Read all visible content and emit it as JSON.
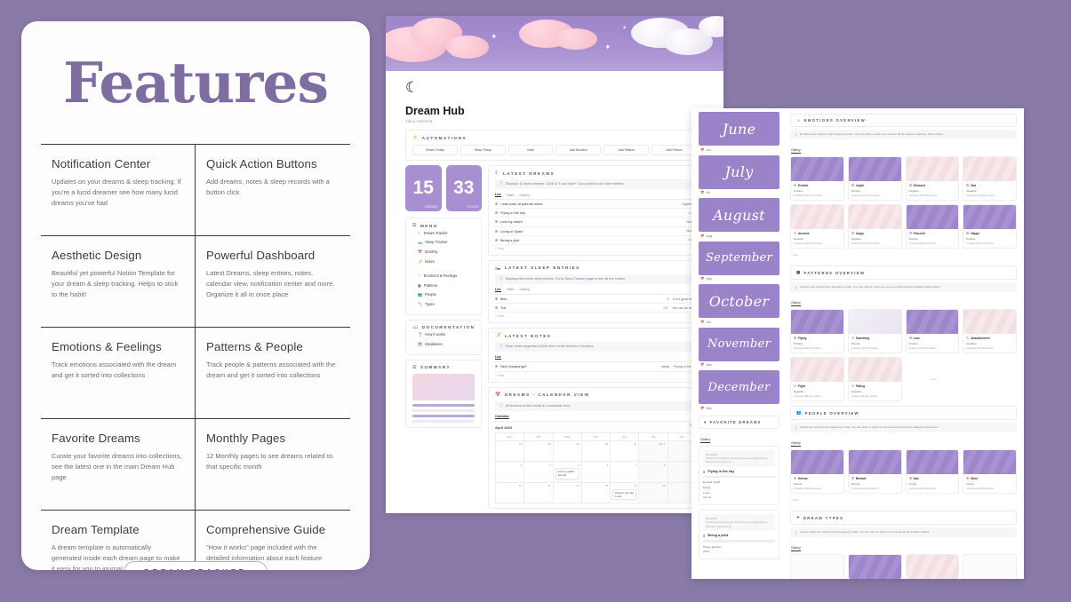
{
  "theme": {
    "background": "#8a7aa8",
    "accent": "#7e6da0",
    "card": "#ffffff",
    "notion_purple": "#a78fd0"
  },
  "features_card": {
    "title": "Features",
    "badge": "DREAM TRACKER",
    "items": [
      {
        "title": "Notification Center",
        "desc": "Updates on your dreams & sleep tracking, if you're a lucid dreamer see how many lucid dreams you've had"
      },
      {
        "title": "Quick Action Buttons",
        "desc": "Add dreams, notes & sleep records with a button click"
      },
      {
        "title": "Aesthetic Design",
        "desc": "Beautiful yet powerful Notion Template for your dream & sleep tracking. Helps to stick to the habit!"
      },
      {
        "title": "Powerful Dashboard",
        "desc": "Latest Dreams, sleep entries, notes, calendar view, notification center and more. Organize it all in once place"
      },
      {
        "title": "Emotions & Feelings",
        "desc": "Track emotions associated with the dream and get it sorted into collections"
      },
      {
        "title": "Patterns & People",
        "desc": "Track people & patterns associated with the dream and get it sorted into collections"
      },
      {
        "title": "Favorite Dreams",
        "desc": "Curate your favorite dreams into collections, see the latest one in the main Dream Hub page"
      },
      {
        "title": "Monthly Pages",
        "desc": "12 Monthly pages to see dreams related to that specific month"
      },
      {
        "title": "Dream Template",
        "desc": "A dream template is automatically generated inside each dream page to make it easy for you to journal"
      },
      {
        "title": "Comprehensive Guide",
        "desc": "\"How it works\" page included with the detailed information about each feature"
      }
    ]
  },
  "notion": {
    "icon": "☾",
    "title": "Dream Hub",
    "subtitle": "Add a comment",
    "automations": {
      "heading": "AUTOMATIONS",
      "buttons": [
        "Dream Today",
        "Sleep Today",
        "Note",
        "Add Emotion",
        "Add Pattern",
        "Add Person"
      ]
    },
    "stats": [
      {
        "value": "15",
        "caption": "DREAMS"
      },
      {
        "value": "33",
        "caption": "HOURS"
      }
    ],
    "menu": {
      "heading": "MENU",
      "items": [
        "Dream Tracker",
        "Sleep Tracker",
        "Monthly",
        "Notes"
      ],
      "items2": [
        "Emotions & Feelings",
        "Patterns",
        "People",
        "Types"
      ]
    },
    "documentation": {
      "heading": "DOCUMENTATION",
      "items": [
        "How it works",
        "Databases"
      ]
    },
    "summary": {
      "heading": "SUMMARY"
    },
    "latest_dreams": {
      "heading": "LATEST DREAMS",
      "callout": "Displays 10 latest dreams. Click to \"Load more\" if you want to see older entries.",
      "tabs": [
        "List",
        "Table",
        "Gallery"
      ],
      "rows": [
        {
          "name": "I was back at parents home",
          "tag": "Nightmare"
        },
        {
          "name": "Flying in the sky",
          "tag": "Lucid"
        },
        {
          "name": "Lost my watch",
          "tag": "Normal"
        },
        {
          "name": "Living in Spain",
          "tag": "Normal"
        },
        {
          "name": "Being a pilot",
          "tag": "Lucid"
        }
      ],
      "new_label": "+ New"
    },
    "latest_sleep": {
      "heading": "LATEST SLEEP ENTRIES",
      "callout": "Displays this week sleep entries. Go to Sleep Tracker page to see all the entries.",
      "tabs": [
        "List",
        "Table",
        "Gallery"
      ],
      "rows": [
        {
          "name": "Mon",
          "value": "8",
          "tag": "8 hrs good sleep"
        },
        {
          "name": "Tue",
          "value": "7.5",
          "tag": "You can do better"
        }
      ],
      "new_label": "+ New"
    },
    "latest_notes": {
      "heading": "LATEST NOTES",
      "callout": "Keep notes organized & link them to the dreams it involves.",
      "tabs": [
        "List"
      ],
      "rows": [
        {
          "name": "New Dreamings?",
          "tag": "Ideas",
          "link": "Flying in the sky"
        }
      ],
      "new_label": "+ New"
    },
    "calendar": {
      "heading": "DREAMS - CALENDAR VIEW",
      "callout": "All dreams of this month in a calendar view.",
      "tab": "Calendar",
      "month": "April 2023",
      "today": "Today",
      "weekdays": [
        "Mon",
        "Tue",
        "Wed",
        "Thu",
        "Fri",
        "Sat",
        "Sun"
      ],
      "cells": [
        {
          "day": "27"
        },
        {
          "day": "28"
        },
        {
          "day": "29"
        },
        {
          "day": "30"
        },
        {
          "day": "31"
        },
        {
          "day": "Apr 1"
        },
        {
          "day": "2"
        },
        {
          "day": "3"
        },
        {
          "day": "4"
        },
        {
          "day": "5"
        },
        {
          "day": "6"
        },
        {
          "day": "7"
        },
        {
          "day": "8"
        },
        {
          "day": "9"
        },
        {
          "day": "10"
        },
        {
          "day": "11"
        },
        {
          "day": "12"
        },
        {
          "day": "13"
        },
        {
          "day": "14"
        },
        {
          "day": "15"
        },
        {
          "day": "16"
        }
      ],
      "events": [
        {
          "cell": 9,
          "name": "Lost my watch",
          "tag": "Normal"
        },
        {
          "cell": 18,
          "name": "Flying in the sky",
          "tag": "Lucid"
        }
      ]
    }
  },
  "right_panel": {
    "months": [
      {
        "name": "June",
        "label": "Jun"
      },
      {
        "name": "July",
        "label": "Jul"
      },
      {
        "name": "August",
        "label": "Aug"
      },
      {
        "name": "September",
        "label": "Sep"
      },
      {
        "name": "October",
        "label": "Oct"
      },
      {
        "name": "November",
        "label": "Nov"
      },
      {
        "name": "December",
        "label": "Dec"
      }
    ],
    "favorites": {
      "heading": "FAVORITE DREAMS",
      "tab": "Gallery",
      "cards": [
        {
          "journal_label": "JOURNAL",
          "journal_text": "I dreamt you're flying over the school, everything was so light and I wanted to fly",
          "title": "Flying in the sky",
          "meta": [
            "Excited  Joyful",
            "Flying",
            "Lucid",
            "Apr 14"
          ]
        },
        {
          "journal_label": "JOURNAL",
          "journal_text": "I dreamt you're flying over the school, everything was so light and I wanted to fly",
          "title": "Being a pilot",
          "meta": [
            "Happy  Excited",
            "Work"
          ]
        }
      ]
    },
    "emotions": {
      "heading": "EMOTIONS OVERVIEW",
      "callout": "Emotions are sorted in the Frequency order. You can click on each one and see all the dreams related to that emotion.",
      "tab": "Gallery",
      "cards": [
        {
          "name": "Excited",
          "type": "Positive",
          "count": "5 dreams with this emotion",
          "img": "purple"
        },
        {
          "name": "Joyful",
          "type": "Positive",
          "count": "4 dreams with this emotion",
          "img": "purple"
        },
        {
          "name": "Stressed",
          "type": "Negative",
          "count": "3 dreams with this emotion",
          "img": "pink"
        },
        {
          "name": "Sad",
          "type": "Negative",
          "count": "3 dreams with this emotion",
          "img": "pink"
        },
        {
          "name": "Anxious",
          "type": "Negative",
          "count": "2 dreams with this emotion",
          "img": "pink"
        },
        {
          "name": "Angry",
          "type": "Negative",
          "count": "2 dreams with this emotion",
          "img": "pink"
        },
        {
          "name": "Peaceful",
          "type": "Positive",
          "count": "1 dream with this emotion",
          "img": "purple"
        },
        {
          "name": "Happy",
          "type": "Positive",
          "count": "1 dream with this emotion",
          "img": "purple"
        }
      ],
      "new_label": "+ New"
    },
    "patterns": {
      "heading": "PATTERNS OVERVIEW",
      "callout": "Patterns are sorted in the Frequency order. You can click on each one and see all the dreams related to that pattern.",
      "tab": "Gallery",
      "cards": [
        {
          "name": "Flying",
          "type": "Positive",
          "count": "5 dreams with this pattern",
          "img": "purple"
        },
        {
          "name": "Searching",
          "type": "Neutral",
          "count": "3 dreams with this pattern",
          "img": "white"
        },
        {
          "name": "Love",
          "type": "Positive",
          "count": "3 dreams with this pattern",
          "img": "purple"
        },
        {
          "name": "Abandonment",
          "type": "Negative",
          "count": "2 dreams with this pattern",
          "img": "pink"
        },
        {
          "name": "Fight",
          "type": "Negative",
          "count": "2 dreams with this pattern",
          "img": "pink"
        },
        {
          "name": "Falling",
          "type": "Negative",
          "count": "1 dream with this pattern",
          "img": "pink"
        }
      ],
      "new_label": "+ New"
    },
    "people": {
      "heading": "PEOPLE OVERVIEW",
      "callout": "People are sorted in the Frequency order. You can click on each one and see all the dreams related to this person.",
      "tab": "Gallery",
      "cards": [
        {
          "name": "Helena",
          "type": "Friends",
          "count": "5 dreams with this person",
          "img": "purple"
        },
        {
          "name": "Michael",
          "type": "Friends",
          "count": "4 dreams with this person",
          "img": "purple"
        },
        {
          "name": "Dad",
          "type": "Family",
          "count": "3 dreams with this person",
          "img": "purple"
        },
        {
          "name": "Mom",
          "type": "Family",
          "count": "3 dreams with this person",
          "img": "purple"
        }
      ],
      "new_label": "+ New"
    },
    "dream_types": {
      "heading": "DREAM TYPES",
      "callout": "Dream Types are sorted in the Frequency order. You can click on each one and see all the dreams related.",
      "tab": "Gallery"
    }
  }
}
